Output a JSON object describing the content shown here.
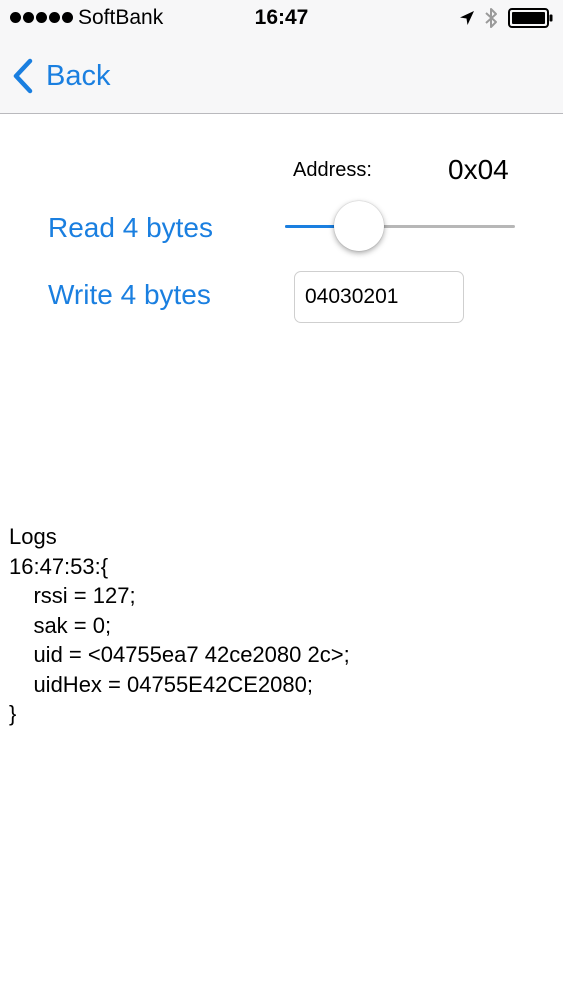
{
  "status_bar": {
    "carrier": "SoftBank",
    "time": "16:47",
    "signal_bars": 5,
    "icons": [
      "location-arrow-icon",
      "bluetooth-icon",
      "battery-icon"
    ]
  },
  "nav": {
    "back_label": "Back"
  },
  "address": {
    "label": "Address:",
    "value": "0x04"
  },
  "actions": {
    "read_label": "Read 4 bytes",
    "write_label": "Write 4 bytes"
  },
  "slider": {
    "fraction": 0.32
  },
  "write_field": {
    "value": "04030201"
  },
  "logs": {
    "title": "Logs",
    "lines": [
      "16:47:53:{",
      "    rssi = 127;",
      "    sak = 0;",
      "    uid = <04755ea7 42ce2080 2c>;",
      "    uidHex = 04755E42CE2080;",
      "}"
    ]
  },
  "colors": {
    "accent": "#1a7fe0",
    "bar_background": "#f7f7f8",
    "slider_track": "#b7b7b7"
  }
}
